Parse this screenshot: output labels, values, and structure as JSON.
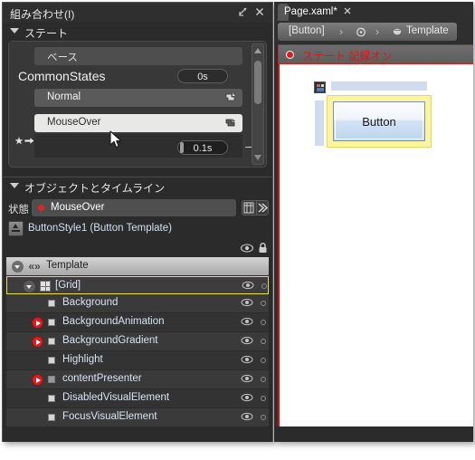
{
  "left_panel": {
    "title": "組み合わせ(I)",
    "popout_icon": "popout-icon",
    "close_icon": "close-icon",
    "states_section": {
      "header": "ステート",
      "base_state": "ベース",
      "group_name": "CommonStates",
      "group_duration": "0s",
      "states": [
        {
          "name": "Normal",
          "hand_icon": "hand-cursor-icon"
        },
        {
          "name": "MouseOver",
          "hand_icon": "hand-cursor-icon"
        }
      ],
      "transition_duration": "0.1s",
      "remove_label": "–",
      "default_transition_icon": "star-arrow-icon",
      "scrollbar": {
        "up_icon": "scroll-up-arrow-icon",
        "down_icon": "scroll-down-arrow-icon"
      }
    },
    "objects_section": {
      "header": "オブジェクトとタイムライン",
      "state_label": "状態",
      "state_value": "MouseOver",
      "grid_icon": "timeline-grid-icon",
      "next_icon": "timeline-next-icon",
      "root_node": "ButtonStyle1 (Button Template)",
      "root_icon": "template-scope-icon",
      "eye_header_icon": "eye-icon",
      "lock_header_icon": "lock-icon",
      "tree": [
        {
          "name": "Template",
          "icon": "chevrons-icon",
          "caret": "caret-circle-icon",
          "indent": 10,
          "kind": "template"
        },
        {
          "name": "[Grid]",
          "icon": "grid-icon",
          "caret": "caret-down-icon",
          "indent": 22,
          "kind": "grid"
        },
        {
          "name": "Background",
          "icon": "rectangle-icon",
          "indent": 44,
          "kind": "leaf"
        },
        {
          "name": "BackgroundAnimation",
          "icon": "rectangle-icon",
          "badge": "play-badge-icon",
          "indent": 44,
          "kind": "leaf"
        },
        {
          "name": "BackgroundGradient",
          "icon": "rectangle-icon",
          "badge": "play-badge-icon",
          "indent": 44,
          "kind": "leaf"
        },
        {
          "name": "Highlight",
          "icon": "rectangle-icon",
          "indent": 44,
          "kind": "leaf"
        },
        {
          "name": "contentPresenter",
          "icon": "content-presenter-icon",
          "badge": "play-badge-icon",
          "indent": 44,
          "kind": "leaf"
        },
        {
          "name": "DisabledVisualElement",
          "icon": "rectangle-icon",
          "indent": 44,
          "kind": "leaf"
        },
        {
          "name": "FocusVisualElement",
          "icon": "rectangle-icon",
          "indent": 44,
          "kind": "leaf"
        }
      ],
      "row_eye_icon": "eye-icon",
      "row_lock_icon": "lock-dot-icon"
    }
  },
  "right_area": {
    "tab": {
      "label": "Page.xaml*",
      "close_icon": "close-icon"
    },
    "breadcrumb": {
      "items": [
        "[Button]",
        "Template"
      ],
      "separator": "›",
      "mid_icon": "template-circle-icon",
      "leaf_icon": "template-node-icon"
    },
    "record_bar": {
      "text": "ステート 記録オン",
      "dot_icon": "record-dot-icon"
    },
    "canvas": {
      "button_caption": "Button",
      "placeholder_icon": "image-placeholder-icon"
    }
  },
  "colors": {
    "panel_bg": "#2b2b2b",
    "record_red": "#e01414",
    "selection_yellow": "#e8e24a",
    "accent_blue": "#cfdcf0",
    "state_dot_red": "#e02424"
  },
  "cursor": {
    "icon": "mouse-pointer-icon"
  }
}
